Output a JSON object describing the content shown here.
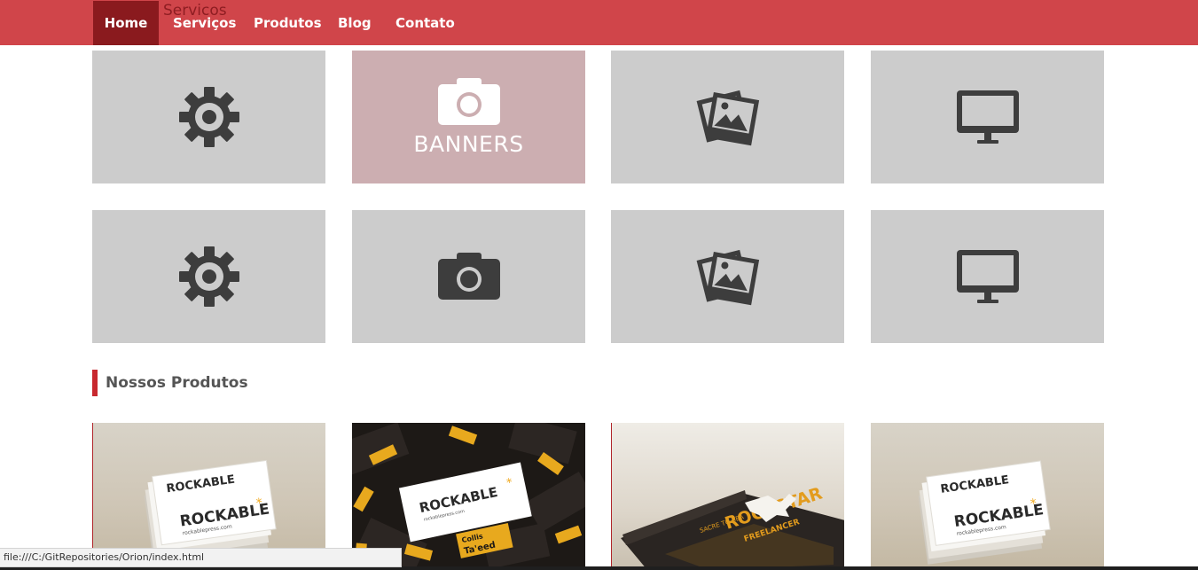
{
  "nav": {
    "ghost_title": "Servicos",
    "items": [
      {
        "label": "Home",
        "active": true
      },
      {
        "label": "Serviços",
        "active": false
      },
      {
        "label": "Produtos",
        "active": false
      },
      {
        "label": "Blog",
        "active": false
      },
      {
        "label": "Contato",
        "active": false
      }
    ]
  },
  "services": {
    "row1": [
      {
        "icon": "gear-icon"
      },
      {
        "icon": "camera-icon",
        "label": "BANNERS",
        "hovered": true
      },
      {
        "icon": "photos-icon"
      },
      {
        "icon": "monitor-icon"
      }
    ],
    "row2": [
      {
        "icon": "gear-icon"
      },
      {
        "icon": "camera-icon"
      },
      {
        "icon": "photos-icon"
      },
      {
        "icon": "monitor-icon"
      }
    ]
  },
  "products": {
    "title": "Nossos Produtos",
    "items": [
      {
        "card_brand": "ROCKABLE",
        "card_site": "rockablepress.com"
      },
      {
        "card_brand": "ROCKABLE",
        "card_site": "rockablepress.com",
        "badge_name": "Collis",
        "badge_name2": "Ta'eed"
      },
      {
        "book_title": "ROCKSTAR",
        "book_sub": "FREELANCER",
        "book_prefix": "SACRE TO BEA"
      },
      {
        "card_brand": "ROCKABLE",
        "card_site": "rockablepress.com"
      }
    ]
  },
  "colors": {
    "nav_bg": "#d0454a",
    "nav_active": "#8a1a1e",
    "tile_bg": "#cccccc",
    "tile_hover": "#ccaeb1",
    "icon": "#3d3d3d",
    "accent": "#c8282e"
  },
  "statusbar": {
    "url": "file:///C:/GitRepositories/Orion/index.html"
  }
}
